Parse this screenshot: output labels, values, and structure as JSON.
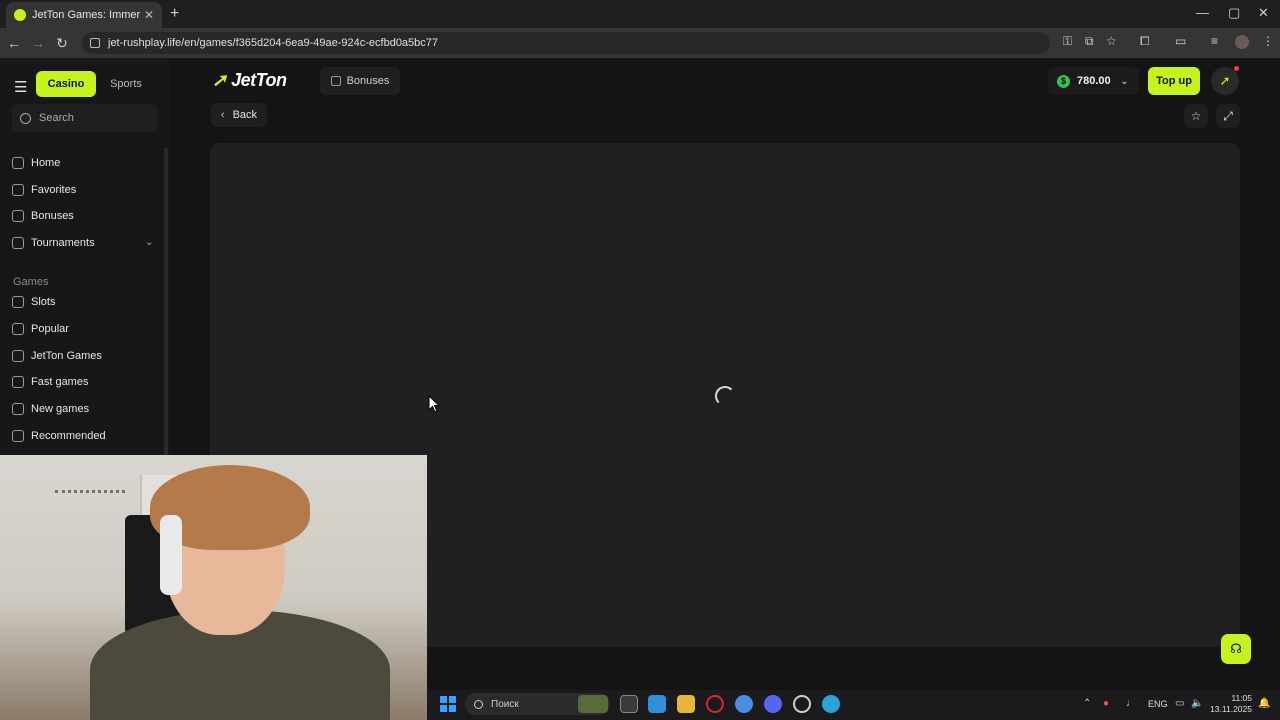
{
  "browser": {
    "tab_title": "JetTon Games: Immerse yourse",
    "url": "jet-rushplay.life/en/games/f365d204-6ea9-49ae-924c-ecfbd0a5bc77",
    "new_tab": "+",
    "win_min": "—",
    "win_max": "▢",
    "win_close": "✕"
  },
  "sidebar": {
    "tabs": {
      "casino": "Casino",
      "sports": "Sports"
    },
    "search_placeholder": "Search",
    "items": [
      {
        "label": "Home"
      },
      {
        "label": "Favorites"
      },
      {
        "label": "Bonuses"
      },
      {
        "label": "Tournaments"
      }
    ],
    "games_header": "Games",
    "games": [
      {
        "label": "Slots"
      },
      {
        "label": "Popular"
      },
      {
        "label": "JetTon Games"
      },
      {
        "label": "Fast games"
      },
      {
        "label": "New games"
      },
      {
        "label": "Recommended"
      }
    ]
  },
  "header": {
    "logo": "JetTon",
    "bonuses": "Bonuses",
    "balance": "780.00",
    "currency_icon": "$",
    "topup": "Top up"
  },
  "game": {
    "back": "Back",
    "favorite_icon": "star-icon",
    "fullscreen_icon": "expand-icon",
    "state": "loading"
  },
  "taskbar": {
    "search": "Поиск",
    "lang": "ENG",
    "time": "11:05",
    "date": "13.11.2025"
  },
  "colors": {
    "accent": "#c6f31e",
    "bg": "#141414",
    "panel": "#202022"
  }
}
